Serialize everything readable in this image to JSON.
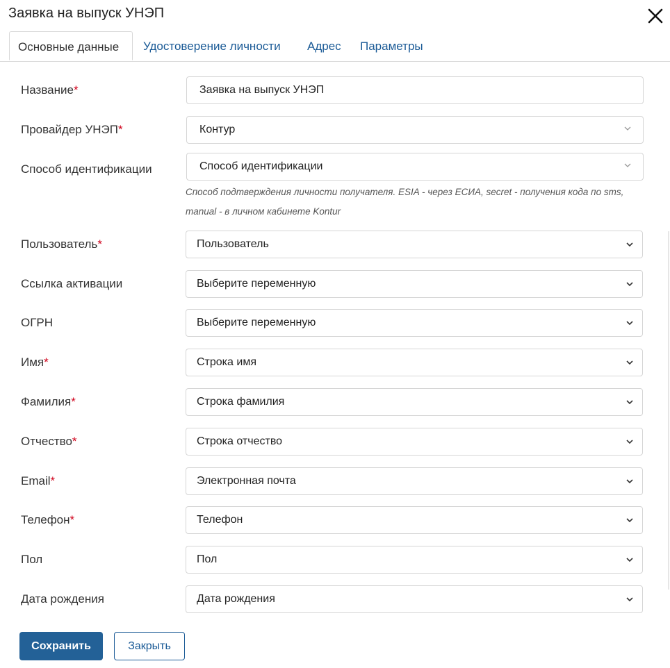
{
  "dialog": {
    "title": "Заявка на выпуск УНЭП",
    "close_icon": "close-icon"
  },
  "tabs": [
    {
      "label": "Основные данные",
      "active": true
    },
    {
      "label": "Удостоверение личности",
      "active": false
    },
    {
      "label": "Адрес",
      "active": false
    },
    {
      "label": "Параметры",
      "active": false
    }
  ],
  "required_mark": "*",
  "fields": {
    "name": {
      "label": "Название",
      "required": true,
      "value": "Заявка на выпуск УНЭП"
    },
    "provider": {
      "label": "Провайдер УНЭП",
      "required": true,
      "value": "Контур"
    },
    "identification": {
      "label": "Способ идентификации",
      "required": false,
      "value": "Способ идентификации",
      "hint": "Способ подтверждения личности получателя. ESIA - через ЕСИА, secret - получения кода по sms, manual - в личном кабинете Kontur"
    },
    "user": {
      "label": "Пользователь",
      "required": true,
      "value": "Пользователь"
    },
    "activation_link": {
      "label": "Ссылка активации",
      "required": false,
      "value": "Выберите переменную"
    },
    "ogrn": {
      "label": "ОГРН",
      "required": false,
      "value": "Выберите переменную"
    },
    "first_name": {
      "label": "Имя",
      "required": true,
      "value": "Строка имя"
    },
    "last_name": {
      "label": "Фамилия",
      "required": true,
      "value": "Строка фамилия"
    },
    "patronymic": {
      "label": "Отчество",
      "required": true,
      "value": "Строка отчество"
    },
    "email": {
      "label": "Email",
      "required": true,
      "value": "Электронная почта"
    },
    "phone": {
      "label": "Телефон",
      "required": true,
      "value": "Телефон"
    },
    "gender": {
      "label": "Пол",
      "required": false,
      "value": "Пол"
    },
    "birth_date": {
      "label": "Дата рождения",
      "required": false,
      "value": "Дата рождения"
    }
  },
  "buttons": {
    "save": "Сохранить",
    "close": "Закрыть"
  },
  "colors": {
    "primary": "#236197",
    "link": "#1a5a96",
    "required": "#d0021b",
    "border": "#d5d5d5"
  }
}
